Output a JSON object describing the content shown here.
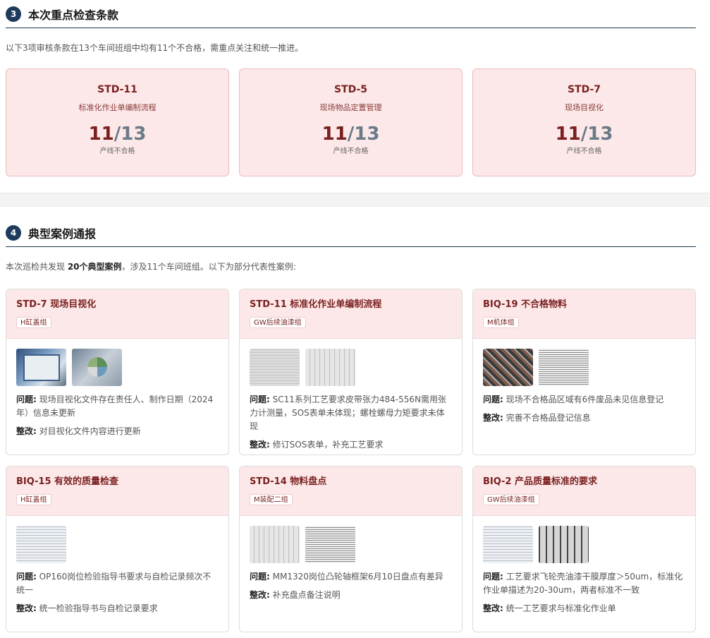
{
  "section3": {
    "number": "3",
    "title": "本次重点检查条款",
    "desc": "以下3项审核条款在13个车间班组中均有11个不合格，需重点关注和统一推进。",
    "cards": [
      {
        "code": "STD-11",
        "name": "标准化作业单编制流程",
        "fail": "11",
        "total": "/13",
        "note": "产线不合格"
      },
      {
        "code": "STD-5",
        "name": "现场物品定置管理",
        "fail": "11",
        "total": "/13",
        "note": "产线不合格"
      },
      {
        "code": "STD-7",
        "name": "现场目视化",
        "fail": "11",
        "total": "/13",
        "note": "产线不合格"
      }
    ]
  },
  "section4": {
    "number": "4",
    "title": "典型案例通报",
    "desc_prefix": "本次巡检共发现 ",
    "desc_bold": "20个典型案例",
    "desc_suffix": "，涉及11个车间班组。以下为部分代表性案例:",
    "issue_label": "问题:",
    "fix_label": "整改:",
    "cases": [
      {
        "title": "STD-7 现场目视化",
        "tag": "H缸盖组",
        "issue": "现场目视化文件存在责任人、制作日期（2024年）信息未更新",
        "fix": "对目视化文件内容进行更新"
      },
      {
        "title": "STD-11 标准化作业单编制流程",
        "tag": "GW后续油漆组",
        "issue": "SC11系列工艺要求皮带张力484-556N需用张力计测量，SOS表单未体现；螺栓螺母力矩要求未体现",
        "fix": "修订SOS表单，补充工艺要求"
      },
      {
        "title": "BIQ-19 不合格物料",
        "tag": "M机体组",
        "issue": "现场不合格品区域有6件废品未见信息登记",
        "fix": "完善不合格品登记信息"
      },
      {
        "title": "BIQ-15 有效的质量检查",
        "tag": "H缸盖组",
        "issue": "OP160岗位检验指导书要求与自检记录频次不统一",
        "fix": "统一检验指导书与自检记录要求"
      },
      {
        "title": "STD-14 物料盘点",
        "tag": "M装配二组",
        "issue": "MM1320岗位凸轮轴框架6月10日盘点有差异",
        "fix": "补充盘点备注说明"
      },
      {
        "title": "BIQ-2 产品质量标准的要求",
        "tag": "GW后续油漆组",
        "issue": "工艺要求飞轮壳油漆干膜厚度＞50um，标准化作业单描述为20-30um，两者标准不一致",
        "fix": "统一工艺要求与标准化作业单"
      }
    ]
  }
}
